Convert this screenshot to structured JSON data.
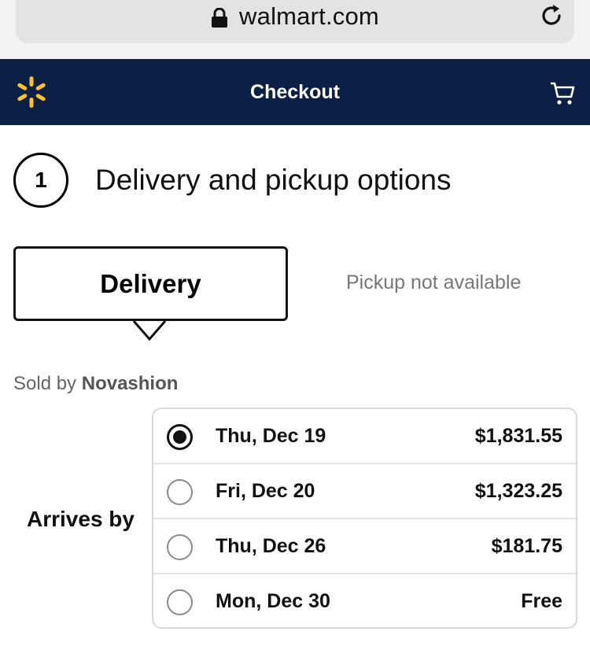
{
  "browser": {
    "url": "walmart.com",
    "icons": [
      "lock-icon",
      "reload-icon"
    ]
  },
  "header": {
    "title": "Checkout",
    "icons": [
      "walmart-spark-icon",
      "cart-icon"
    ],
    "colors": {
      "background": "#0c1f45",
      "spark": "#ffc220"
    }
  },
  "step": {
    "number": "1",
    "title": "Delivery and pickup options"
  },
  "tabs": {
    "delivery": "Delivery",
    "pickup": "Pickup not available"
  },
  "seller": {
    "prefix": "Sold by",
    "name": "Novashion"
  },
  "arrives_label": "Arrives by",
  "options": [
    {
      "date": "Thu, Dec 19",
      "price": "$1,831.55",
      "selected": true
    },
    {
      "date": "Fri, Dec 20",
      "price": "$1,323.25",
      "selected": false
    },
    {
      "date": "Thu, Dec 26",
      "price": "$181.75",
      "selected": false
    },
    {
      "date": "Mon, Dec 30",
      "price": "Free",
      "selected": false
    }
  ]
}
